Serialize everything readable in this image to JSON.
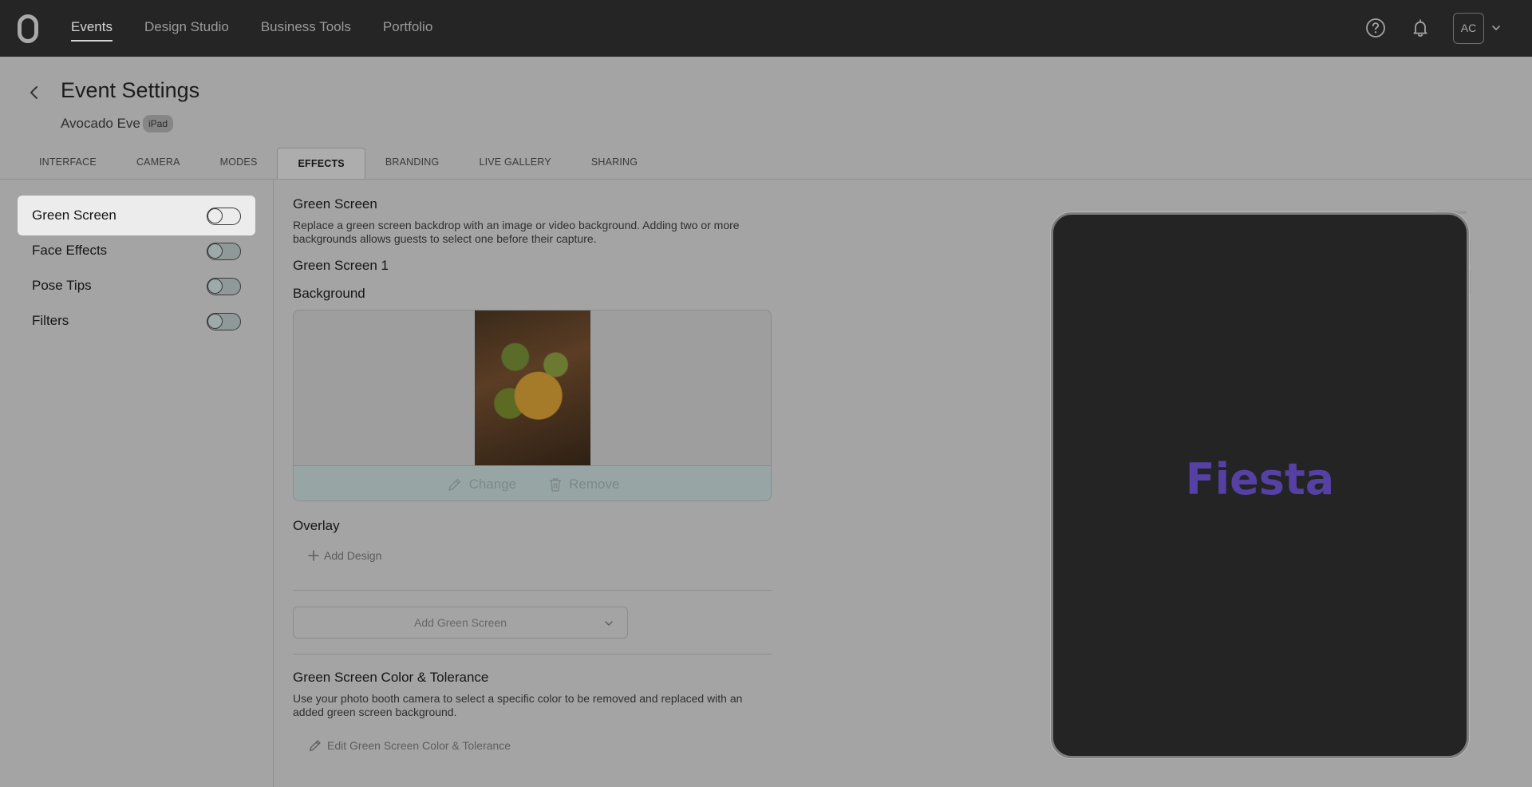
{
  "nav": {
    "items": [
      "Events",
      "Design Studio",
      "Business Tools",
      "Portfolio"
    ],
    "active_index": 0,
    "avatar_initials": "AC",
    "icons": [
      "help-icon",
      "bell-icon",
      "chevron-down-icon"
    ]
  },
  "header": {
    "title": "Event Settings",
    "event_name": "Avocado Eve",
    "device_badge": "iPad"
  },
  "tabs": [
    "INTERFACE",
    "CAMERA",
    "MODES",
    "EFFECTS",
    "BRANDING",
    "LIVE GALLERY",
    "SHARING"
  ],
  "active_tab": "EFFECTS",
  "sidebar": {
    "items": [
      {
        "label": "Green Screen",
        "enabled": false,
        "selected": true
      },
      {
        "label": "Face Effects",
        "enabled": false,
        "selected": false
      },
      {
        "label": "Pose Tips",
        "enabled": false,
        "selected": false
      },
      {
        "label": "Filters",
        "enabled": false,
        "selected": false
      }
    ]
  },
  "main": {
    "title": "Green Screen",
    "description": "Replace a green screen backdrop with an image or video background. Adding two or more backgrounds allows guests to select one before their capture.",
    "screen_title": "Green Screen 1",
    "background_label": "Background",
    "change_label": "Change",
    "remove_label": "Remove",
    "overlay_label": "Overlay",
    "add_design_label": "Add Design",
    "add_green_screen_label": "Add Green Screen",
    "color_title": "Green Screen Color & Tolerance",
    "color_description": "Use your photo booth camera to select a specific color to be removed and replaced with an added green screen background.",
    "edit_color_label": "Edit Green Screen Color & Tolerance"
  },
  "preview": {
    "text": "Fiesta",
    "text_color": "#5640a4"
  }
}
